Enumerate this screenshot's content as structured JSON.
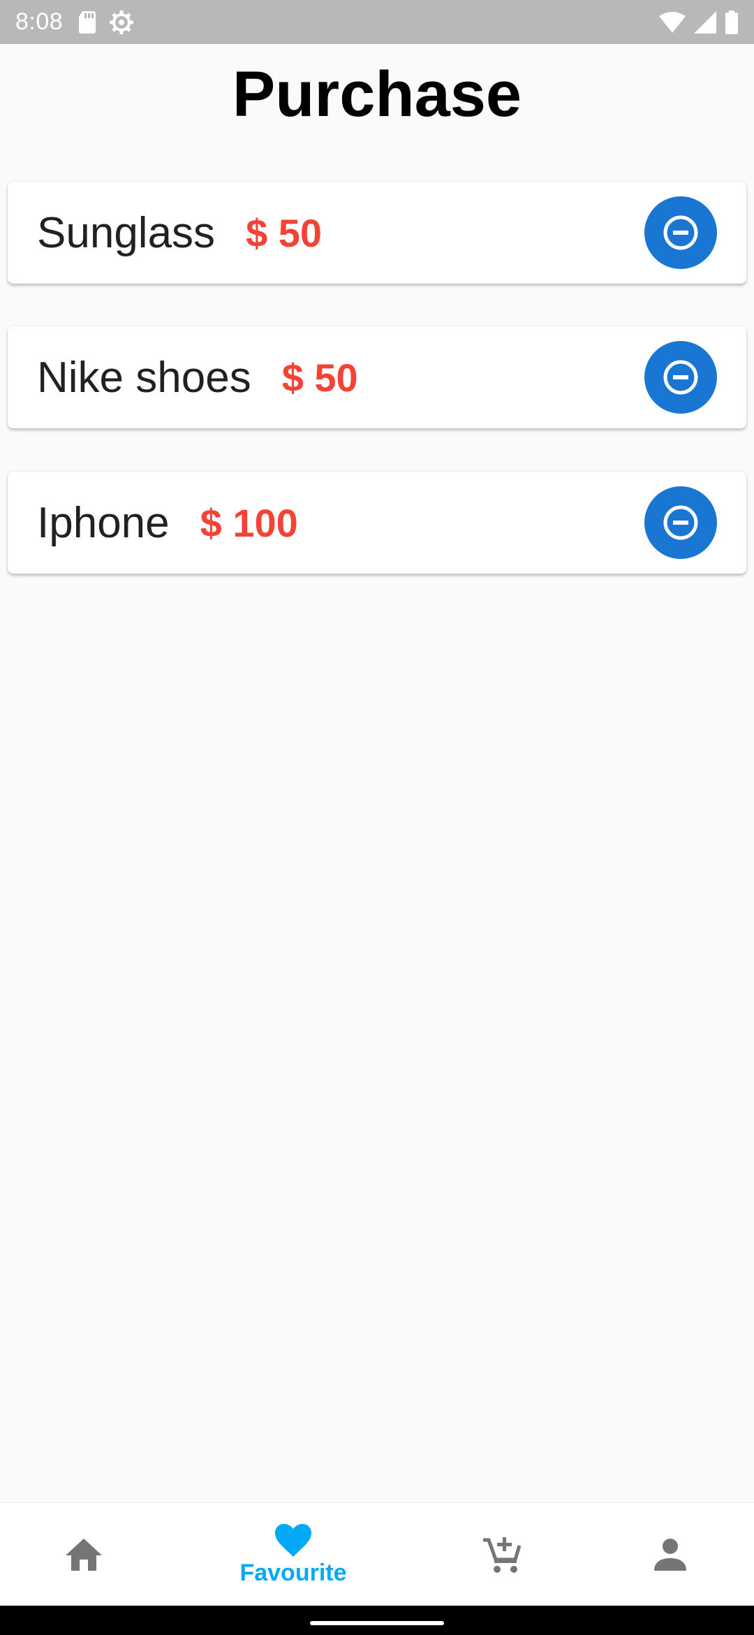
{
  "status_bar": {
    "time": "8:08",
    "left_icons": [
      "sd-card-icon",
      "settings-gear-icon"
    ],
    "right_icons": [
      "wifi-icon",
      "cell-signal-icon",
      "battery-icon"
    ]
  },
  "header": {
    "title": "Purchase"
  },
  "purchases": [
    {
      "name": "Sunglass",
      "price": "$ 50",
      "action_icon": "remove-circle-icon"
    },
    {
      "name": "Nike shoes",
      "price": "$ 50",
      "action_icon": "remove-circle-icon"
    },
    {
      "name": "Iphone",
      "price": "$ 100",
      "action_icon": "remove-circle-icon"
    }
  ],
  "bottom_nav": {
    "items": [
      {
        "icon": "home-icon",
        "label": "",
        "active": false
      },
      {
        "icon": "heart-icon",
        "label": "Favourite",
        "active": true
      },
      {
        "icon": "add-to-cart-icon",
        "label": "",
        "active": false
      },
      {
        "icon": "person-icon",
        "label": "",
        "active": false
      }
    ]
  },
  "colors": {
    "status_bar": "#b8b8b8",
    "price": "#f44336",
    "remove_button": "#1976d2",
    "nav_active": "#03a9f4",
    "nav_inactive": "#757575",
    "background": "#fafafa"
  }
}
